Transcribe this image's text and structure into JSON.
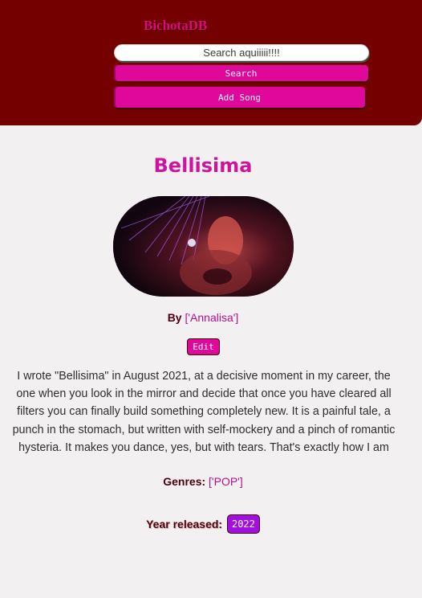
{
  "header": {
    "brand": "BichotaDB",
    "search_placeholder": "Search aquiiiii!!!!",
    "search_button": "Search",
    "add_song_button": "Add Song"
  },
  "song": {
    "title": "Bellisima",
    "by_label": "By",
    "artists": "['Annalisa']",
    "edit_button": "Edit",
    "description": "I wrote \"Bellisima\" in August 2021, at a decisive moment in my career, the one when you look in the mirror and decide that once you have cleared all filters you can finally build something completely new. It is a painful tale, a punch in the stomach, but written with self-mockery and a pinch of romantic hysteria. It makes you dance, yes, but with tears. That's exactly how I am",
    "genres_label": "Genres:",
    "genres": "['POP']",
    "year_label": "Year released:",
    "year": "2022"
  },
  "colors": {
    "header_bg": "#740000",
    "accent_pink": "#e0089a",
    "year_badge": "#a30fe0",
    "page_bg": "#f3f0f2"
  }
}
